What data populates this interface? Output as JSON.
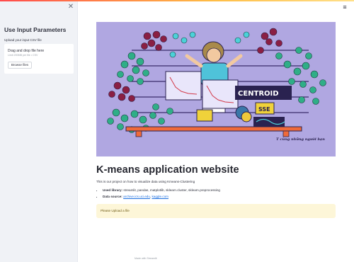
{
  "sidebar": {
    "close_icon": "close-icon",
    "title": "Use Input Parameters",
    "upload_label": "Upload your input CSV file",
    "uploader": {
      "drop_text": "Drag and drop file here",
      "limit_text": "Limit 200MB per file • CSV",
      "browse_label": "Browse files"
    }
  },
  "header": {
    "menu_icon": "hamburger-menu-icon"
  },
  "hero": {
    "board_text": "CENTROID",
    "sse_text": "SSE",
    "credit": "T cùng những người bạn"
  },
  "main": {
    "title": "K-means application website",
    "intro": "This is our project on how to visualize data using Kmeans-Clustering",
    "libs_label": "Used library:",
    "libs_value": "streamlit, pandas, matplotlib, sklearn.cluster, sklearn.preprocessing",
    "source_label": "Data source:",
    "source_link_1": "archive.ics.uci.edu",
    "source_sep": ",",
    "source_link_2": "kaggle.com",
    "alert": "Please Upload a file"
  },
  "footer": {
    "text": "Made with Streamlit"
  },
  "colors": {
    "hero_bg": "#b0a7e1",
    "alert_bg": "#fdf6d8",
    "link": "#1c6fe0"
  }
}
